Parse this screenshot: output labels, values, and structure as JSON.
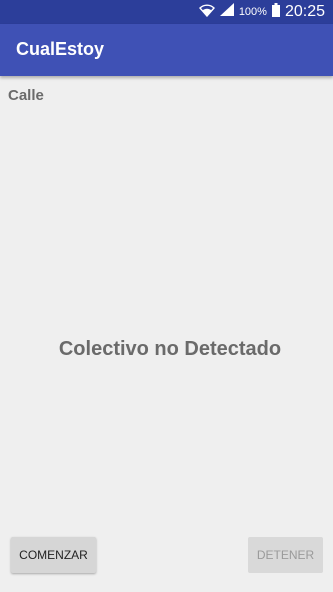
{
  "status_bar": {
    "battery": "100%",
    "time": "20:25",
    "icons": [
      "wifi-icon",
      "signal-icon",
      "battery-icon"
    ]
  },
  "app_bar": {
    "title": "CualEstoy"
  },
  "main": {
    "street_label": "Calle",
    "detection_status": "Colectivo no Detectado"
  },
  "buttons": {
    "start_label": "COMENZAR",
    "stop_label": "DETENER",
    "stop_enabled": false
  },
  "colors": {
    "status_bar": "#2c3e9a",
    "app_bar": "#3f51b5",
    "background": "#efefef"
  }
}
